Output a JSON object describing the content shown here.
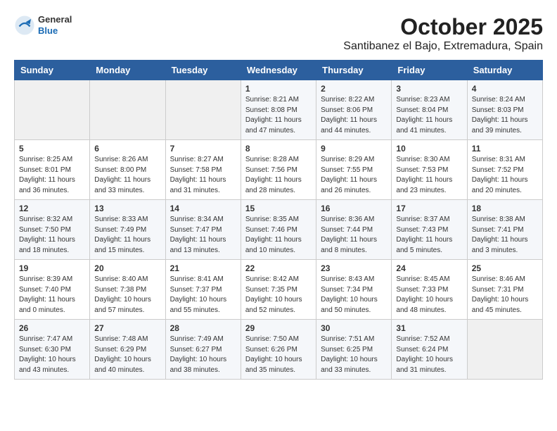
{
  "header": {
    "logo_general": "General",
    "logo_blue": "Blue",
    "title": "October 2025",
    "subtitle": "Santibanez el Bajo, Extremadura, Spain"
  },
  "weekdays": [
    "Sunday",
    "Monday",
    "Tuesday",
    "Wednesday",
    "Thursday",
    "Friday",
    "Saturday"
  ],
  "weeks": [
    [
      {
        "day": "",
        "info": ""
      },
      {
        "day": "",
        "info": ""
      },
      {
        "day": "",
        "info": ""
      },
      {
        "day": "1",
        "info": "Sunrise: 8:21 AM\nSunset: 8:08 PM\nDaylight: 11 hours and 47 minutes."
      },
      {
        "day": "2",
        "info": "Sunrise: 8:22 AM\nSunset: 8:06 PM\nDaylight: 11 hours and 44 minutes."
      },
      {
        "day": "3",
        "info": "Sunrise: 8:23 AM\nSunset: 8:04 PM\nDaylight: 11 hours and 41 minutes."
      },
      {
        "day": "4",
        "info": "Sunrise: 8:24 AM\nSunset: 8:03 PM\nDaylight: 11 hours and 39 minutes."
      }
    ],
    [
      {
        "day": "5",
        "info": "Sunrise: 8:25 AM\nSunset: 8:01 PM\nDaylight: 11 hours and 36 minutes."
      },
      {
        "day": "6",
        "info": "Sunrise: 8:26 AM\nSunset: 8:00 PM\nDaylight: 11 hours and 33 minutes."
      },
      {
        "day": "7",
        "info": "Sunrise: 8:27 AM\nSunset: 7:58 PM\nDaylight: 11 hours and 31 minutes."
      },
      {
        "day": "8",
        "info": "Sunrise: 8:28 AM\nSunset: 7:56 PM\nDaylight: 11 hours and 28 minutes."
      },
      {
        "day": "9",
        "info": "Sunrise: 8:29 AM\nSunset: 7:55 PM\nDaylight: 11 hours and 26 minutes."
      },
      {
        "day": "10",
        "info": "Sunrise: 8:30 AM\nSunset: 7:53 PM\nDaylight: 11 hours and 23 minutes."
      },
      {
        "day": "11",
        "info": "Sunrise: 8:31 AM\nSunset: 7:52 PM\nDaylight: 11 hours and 20 minutes."
      }
    ],
    [
      {
        "day": "12",
        "info": "Sunrise: 8:32 AM\nSunset: 7:50 PM\nDaylight: 11 hours and 18 minutes."
      },
      {
        "day": "13",
        "info": "Sunrise: 8:33 AM\nSunset: 7:49 PM\nDaylight: 11 hours and 15 minutes."
      },
      {
        "day": "14",
        "info": "Sunrise: 8:34 AM\nSunset: 7:47 PM\nDaylight: 11 hours and 13 minutes."
      },
      {
        "day": "15",
        "info": "Sunrise: 8:35 AM\nSunset: 7:46 PM\nDaylight: 11 hours and 10 minutes."
      },
      {
        "day": "16",
        "info": "Sunrise: 8:36 AM\nSunset: 7:44 PM\nDaylight: 11 hours and 8 minutes."
      },
      {
        "day": "17",
        "info": "Sunrise: 8:37 AM\nSunset: 7:43 PM\nDaylight: 11 hours and 5 minutes."
      },
      {
        "day": "18",
        "info": "Sunrise: 8:38 AM\nSunset: 7:41 PM\nDaylight: 11 hours and 3 minutes."
      }
    ],
    [
      {
        "day": "19",
        "info": "Sunrise: 8:39 AM\nSunset: 7:40 PM\nDaylight: 11 hours and 0 minutes."
      },
      {
        "day": "20",
        "info": "Sunrise: 8:40 AM\nSunset: 7:38 PM\nDaylight: 10 hours and 57 minutes."
      },
      {
        "day": "21",
        "info": "Sunrise: 8:41 AM\nSunset: 7:37 PM\nDaylight: 10 hours and 55 minutes."
      },
      {
        "day": "22",
        "info": "Sunrise: 8:42 AM\nSunset: 7:35 PM\nDaylight: 10 hours and 52 minutes."
      },
      {
        "day": "23",
        "info": "Sunrise: 8:43 AM\nSunset: 7:34 PM\nDaylight: 10 hours and 50 minutes."
      },
      {
        "day": "24",
        "info": "Sunrise: 8:45 AM\nSunset: 7:33 PM\nDaylight: 10 hours and 48 minutes."
      },
      {
        "day": "25",
        "info": "Sunrise: 8:46 AM\nSunset: 7:31 PM\nDaylight: 10 hours and 45 minutes."
      }
    ],
    [
      {
        "day": "26",
        "info": "Sunrise: 7:47 AM\nSunset: 6:30 PM\nDaylight: 10 hours and 43 minutes."
      },
      {
        "day": "27",
        "info": "Sunrise: 7:48 AM\nSunset: 6:29 PM\nDaylight: 10 hours and 40 minutes."
      },
      {
        "day": "28",
        "info": "Sunrise: 7:49 AM\nSunset: 6:27 PM\nDaylight: 10 hours and 38 minutes."
      },
      {
        "day": "29",
        "info": "Sunrise: 7:50 AM\nSunset: 6:26 PM\nDaylight: 10 hours and 35 minutes."
      },
      {
        "day": "30",
        "info": "Sunrise: 7:51 AM\nSunset: 6:25 PM\nDaylight: 10 hours and 33 minutes."
      },
      {
        "day": "31",
        "info": "Sunrise: 7:52 AM\nSunset: 6:24 PM\nDaylight: 10 hours and 31 minutes."
      },
      {
        "day": "",
        "info": ""
      }
    ]
  ]
}
